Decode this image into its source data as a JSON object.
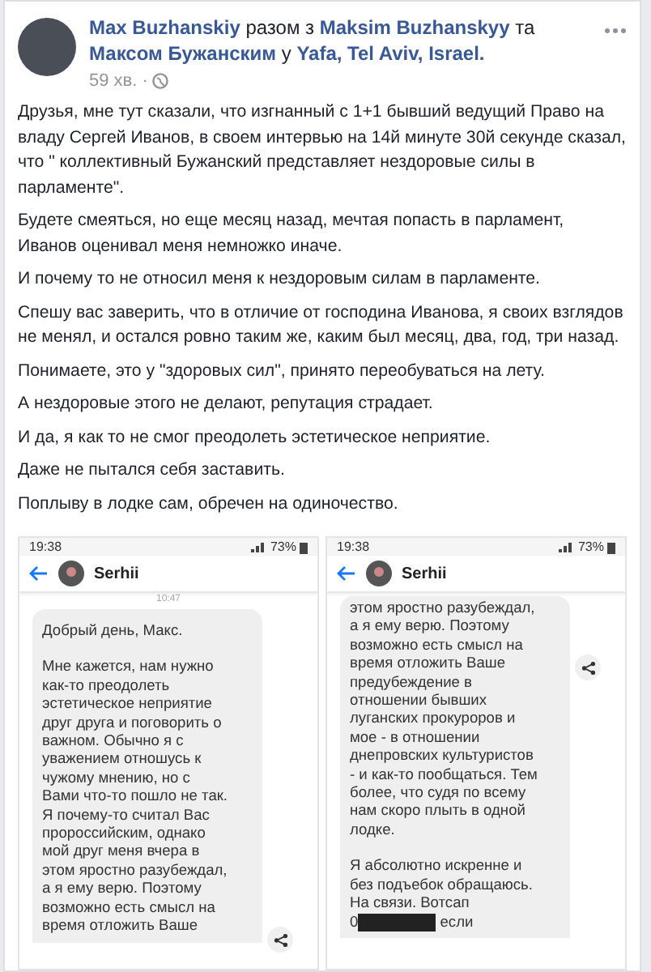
{
  "post": {
    "header": "**Max Buzhanskiy** разом з **Maksim Buzhanskyy** та **Максом Бужанским** у **Yafa, Tel Aviv, Israel.**",
    "time": "59 хв.",
    "separator": "·",
    "paragraphs": [
      "Друзья, мне тут сказали, что изгнанный с 1+1 бывший ведущий Право на владу Сергей Иванов, в своем интервью на 14й минуте 30й секунде сказал, что \" коллективный Бужанский представляет нездоровые силы в парламенте\".",
      "Будете смеяться, но еще месяц назад, мечтая попасть в парламент, Иванов оценивал меня немножко иначе.",
      "И почему то не относил меня к нездоровым силам в парламенте.",
      "Спешу вас заверить, что в отличие от господина Иванова, я своих взглядов не менял, и остался ровно таким же, каким был месяц, два, год, три назад.",
      "Понимаете, это у \"здоровых сил\", принято переобуваться на лету.",
      "А нездоровые этого не делают, репутация страдает.",
      "И да, я как то не смог преодолеть эстетическое неприятие.",
      "Даже не пытался себя заставить.",
      "Поплыву в лодке сам, обречен на одиночество."
    ]
  },
  "screenshots": [
    {
      "status_time": "19:38",
      "battery": "73%",
      "contact": "Serhii",
      "timestamp": "10:47",
      "blocks": [
        [
          "Добрый день, Макс."
        ],
        [
          "Мне кажется, нам нужно",
          "как-то преодолеть",
          "эстетическое неприятие",
          "друг друга и поговорить о",
          "важном. Обычно я с",
          "уважением отношусь к",
          "чужому мнению, но с",
          "Вами что-то пошло не так.",
          "Я почему-то считал Вас",
          "пророссийским, однако",
          "мой друг меня вчера в",
          "этом яростно разубеждал,",
          "а я ему верю. Поэтому",
          "возможно есть смысл на",
          "время отложить Ваше"
        ]
      ]
    },
    {
      "status_time": "19:38",
      "battery": "73%",
      "contact": "Serhii",
      "blocks": [
        [
          "этом яростно разубеждал,",
          "а я ему верю. Поэтому",
          "возможно есть смысл на",
          "время отложить Ваше",
          "предубеждение в",
          "отношении бывших",
          "луганских прокуроров и",
          "мое - в отношении",
          "днепровских культуристов",
          "- и как-то пообщаться. Тем",
          "более, что судя по всему",
          "нам скоро плыть в одной",
          "лодке."
        ],
        [
          "Я абсолютно искренне и",
          "без подъебок обращаюсь.",
          "На связи. Вотсап"
        ]
      ],
      "redacted_prefix": "0",
      "redacted_suffix": "если"
    }
  ]
}
